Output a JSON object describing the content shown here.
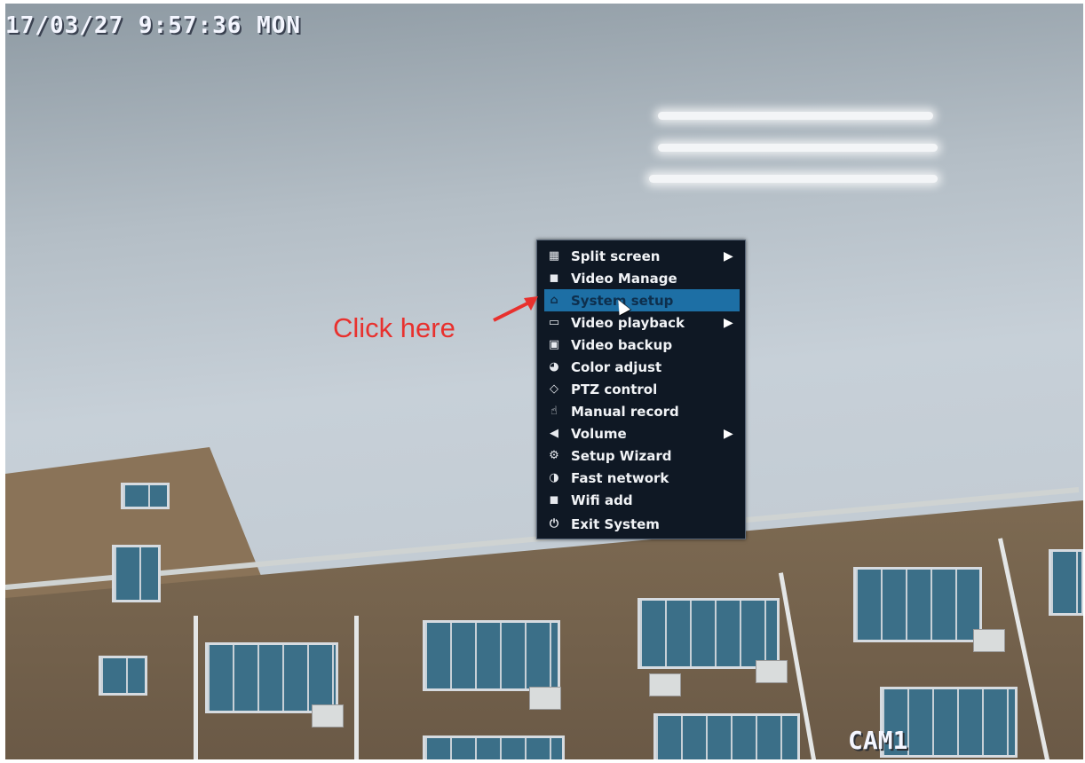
{
  "osd": {
    "datetime": "17/03/27 9:57:36 MON",
    "camera": "CAM1"
  },
  "menu": {
    "items": [
      {
        "label": "Split screen",
        "icon": "grid-icon",
        "glyph": "▦",
        "submenu": true
      },
      {
        "label": "Video Manage",
        "icon": "camera-icon",
        "glyph": "◼",
        "submenu": false
      },
      {
        "label": "System setup",
        "icon": "home-icon",
        "glyph": "⌂",
        "submenu": false,
        "selected": true
      },
      {
        "label": "Video playback",
        "icon": "playback-icon",
        "glyph": "▭",
        "submenu": true
      },
      {
        "label": "Video backup",
        "icon": "floppy-disk-icon",
        "glyph": "▣",
        "submenu": false
      },
      {
        "label": "Color adjust",
        "icon": "palette-icon",
        "glyph": "◕",
        "submenu": false
      },
      {
        "label": "PTZ control",
        "icon": "ptz-icon",
        "glyph": "◇",
        "submenu": false
      },
      {
        "label": "Manual record",
        "icon": "hand-icon",
        "glyph": "☝",
        "submenu": false
      },
      {
        "label": "Volume",
        "icon": "speaker-icon",
        "glyph": "◀",
        "submenu": true
      },
      {
        "label": "Setup Wizard",
        "icon": "gears-icon",
        "glyph": "⚙",
        "submenu": false
      },
      {
        "label": "Fast network",
        "icon": "network-icon",
        "glyph": "◑",
        "submenu": false
      },
      {
        "label": "Wifi add",
        "icon": "wifi-camera-icon",
        "glyph": "◼",
        "submenu": false
      },
      {
        "label": "Exit System",
        "icon": "power-icon",
        "glyph": "⏻",
        "submenu": false
      }
    ],
    "submenu_arrow": "▶",
    "selected_color": "#1d6fa5",
    "background_color": "#0f1824"
  },
  "annotation": {
    "callout_text": "Click here",
    "color": "#e8312e"
  }
}
